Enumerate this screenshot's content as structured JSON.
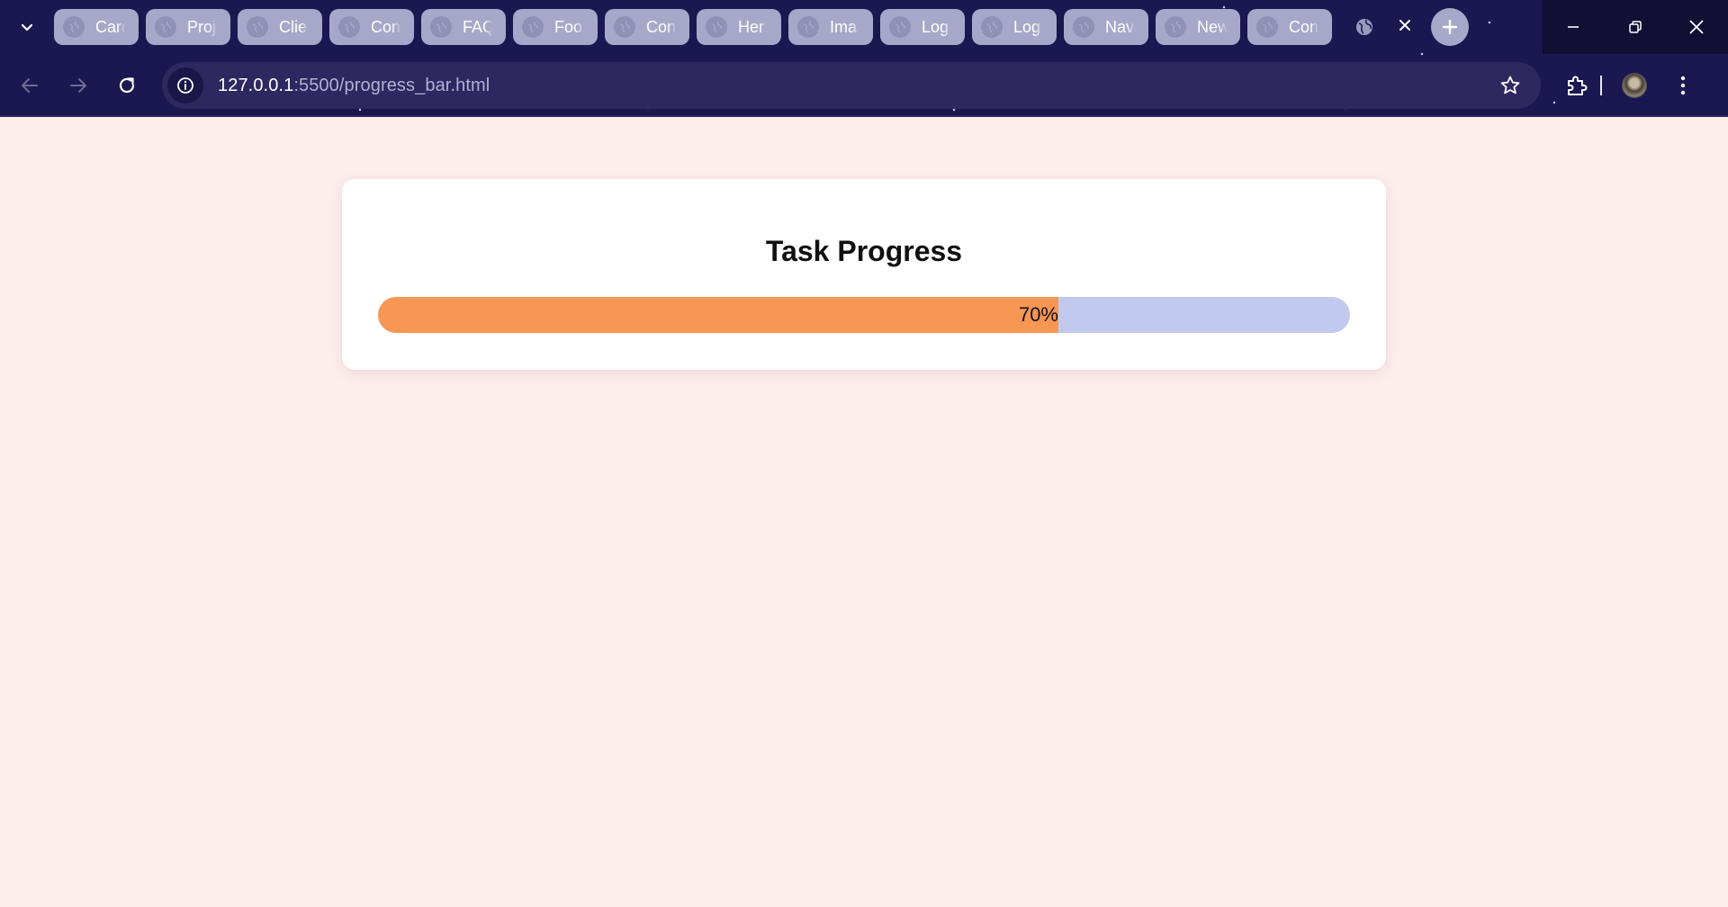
{
  "browser": {
    "tabs": [
      {
        "title": "Card"
      },
      {
        "title": "Proj"
      },
      {
        "title": "Clie"
      },
      {
        "title": "Con"
      },
      {
        "title": "FAQ"
      },
      {
        "title": "Foo"
      },
      {
        "title": "Con"
      },
      {
        "title": "Her"
      },
      {
        "title": "Ima"
      },
      {
        "title": "Log"
      },
      {
        "title": "Log"
      },
      {
        "title": "Nav"
      },
      {
        "title": "New"
      },
      {
        "title": "Con"
      }
    ],
    "address": {
      "host": "127.0.0.1",
      "rest": ":5500/progress_bar.html"
    },
    "icons": {
      "tab_search": "chevron-down-icon",
      "tab_favicon": "globe-icon",
      "active_tab_favicon": "globe-icon",
      "active_tab_close": "close-icon",
      "new_tab": "plus-icon",
      "back": "arrow-left-icon",
      "forward": "arrow-right-icon",
      "reload": "reload-icon",
      "site_info": "info-icon",
      "bookmark": "star-icon",
      "extensions": "puzzle-icon",
      "menu": "kebab-menu-icon",
      "minimize": "minimize-icon",
      "restore": "restore-icon",
      "close_window": "close-icon"
    }
  },
  "page": {
    "title": "Task Progress",
    "progress": {
      "percent": 70,
      "label": "70%"
    }
  },
  "colors": {
    "page_background": "#fdeded",
    "card_background": "#ffffff",
    "progress_fill": "#f89653",
    "progress_track": "#c1c9ee",
    "chrome_background": "#1b1750"
  }
}
